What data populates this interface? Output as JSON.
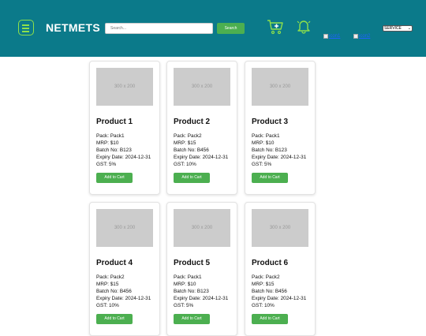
{
  "header": {
    "brand": "NETMETS",
    "search_placeholder": "Search...",
    "search_button": "Search",
    "icon1_alt": "icon1",
    "icon2_alt": "icon2",
    "service_value": "SERVICE",
    "cart_icon": "cart-plus-icon",
    "bell_icon": "bell-icon",
    "accent": "#8ee04a",
    "header_color": "#0b7a8a"
  },
  "products": [
    {
      "image": "300 x 200",
      "name": "Product 1",
      "pack": "Pack: Pack1",
      "mrp": "MRP: $10",
      "batch": "Batch No: B123",
      "expiry": "Expiry Date: 2024-12-31",
      "gst": "GST: 5%",
      "button": "Add to Cart"
    },
    {
      "image": "300 x 200",
      "name": "Product 2",
      "pack": "Pack: Pack2",
      "mrp": "MRP: $15",
      "batch": "Batch No: B456",
      "expiry": "Expiry Date: 2024-12-31",
      "gst": "GST: 10%",
      "button": "Add to Cart"
    },
    {
      "image": "300 x 200",
      "name": "Product 3",
      "pack": "Pack: Pack1",
      "mrp": "MRP: $10",
      "batch": "Batch No: B123",
      "expiry": "Expiry Date: 2024-12-31",
      "gst": "GST: 5%",
      "button": "Add to Cart"
    },
    {
      "image": "300 x 200",
      "name": "Product 4",
      "pack": "Pack: Pack2",
      "mrp": "MRP: $15",
      "batch": "Batch No: B456",
      "expiry": "Expiry Date: 2024-12-31",
      "gst": "GST: 10%",
      "button": "Add to Cart"
    },
    {
      "image": "300 x 200",
      "name": "Product 5",
      "pack": "Pack: Pack1",
      "mrp": "MRP: $10",
      "batch": "Batch No: B123",
      "expiry": "Expiry Date: 2024-12-31",
      "gst": "GST: 5%",
      "button": "Add to Cart"
    },
    {
      "image": "300 x 200",
      "name": "Product 6",
      "pack": "Pack: Pack2",
      "mrp": "MRP: $15",
      "batch": "Batch No: B456",
      "expiry": "Expiry Date: 2024-12-31",
      "gst": "GST: 10%",
      "button": "Add to Cart"
    }
  ]
}
